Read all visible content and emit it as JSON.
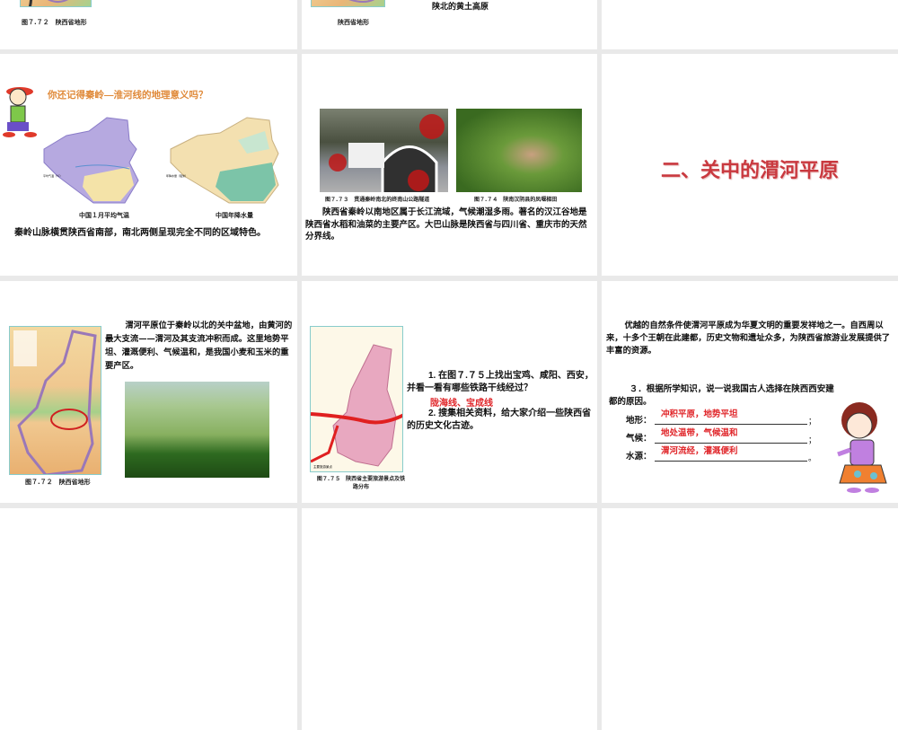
{
  "slides": {
    "top_left": {
      "caption": "图７.７２　陕西省地形"
    },
    "top_middle": {
      "caption": "陕西省地形",
      "text": "陕北的黄土高原"
    },
    "qinling": {
      "question": "你还记得秦岭—淮河线的地理意义吗？",
      "map1_caption": "中国１月平均气温",
      "map2_caption": "中国年降水量",
      "map1_legend": "平均气温（℃）",
      "map2_legend": "年降水量（毫米）",
      "body": "秦岭山脉横贯陕西省南部，南北两侧呈现完全不同的区域特色。"
    },
    "south": {
      "photo1_caption": "图７.７３　贯通秦岭南北的终南山公路隧道",
      "photo2_caption": "图７.７４　陕南汉阴县的凤堰梯田",
      "body": "陕西省秦岭以南地区属于长江流域，气候潮湿多雨。著名的汉江谷地是陕西省水稻和油菜的主要产区。大巴山脉是陕西省与四川省、重庆市的天然分界线。"
    },
    "title_slide": {
      "title": "二、关中的渭河平原",
      "color": "#c9393f"
    },
    "weihe": {
      "map_caption": "图７.７２　陕西省地形",
      "body": "渭河平原位于秦岭以北的关中盆地，由黄河的最大支流——渭河及其支流冲积而成。这里地势平坦、灌溉便利、气候温和，是我国小麦和玉米的重要产区。"
    },
    "railway": {
      "map_caption": "图７.７５　陕西省主要旅游景点及铁路分布",
      "legend": "主要旅游景点",
      "q1": "1. 在图７.７５上找出宝鸡、咸阳、西安，并看一看有哪些铁路干线经过？",
      "a1": "陇海线、宝成线",
      "q2": "2. 搜集相关资料，给大家介绍一些陕西省的历史文化古迹。"
    },
    "capital": {
      "body": "优越的自然条件使渭河平原成为华夏文明的重要发祥地之一。自西周以来，十多个王朝在此建都，历史文物和遗址众多，为陕西省旅游业发展提供了丰富的资源。",
      "q3": "３．根据所学知识，说一说我国古人选择在陕西西安建都的原因。",
      "fields": [
        {
          "label": "地形：",
          "answer": "冲积平原，地势平坦",
          "end": "；"
        },
        {
          "label": "气候：",
          "answer": "地处温带，气候温和",
          "end": "；"
        },
        {
          "label": "水源：",
          "answer": "渭河流经，灌溉便利",
          "end": "。"
        }
      ]
    }
  }
}
